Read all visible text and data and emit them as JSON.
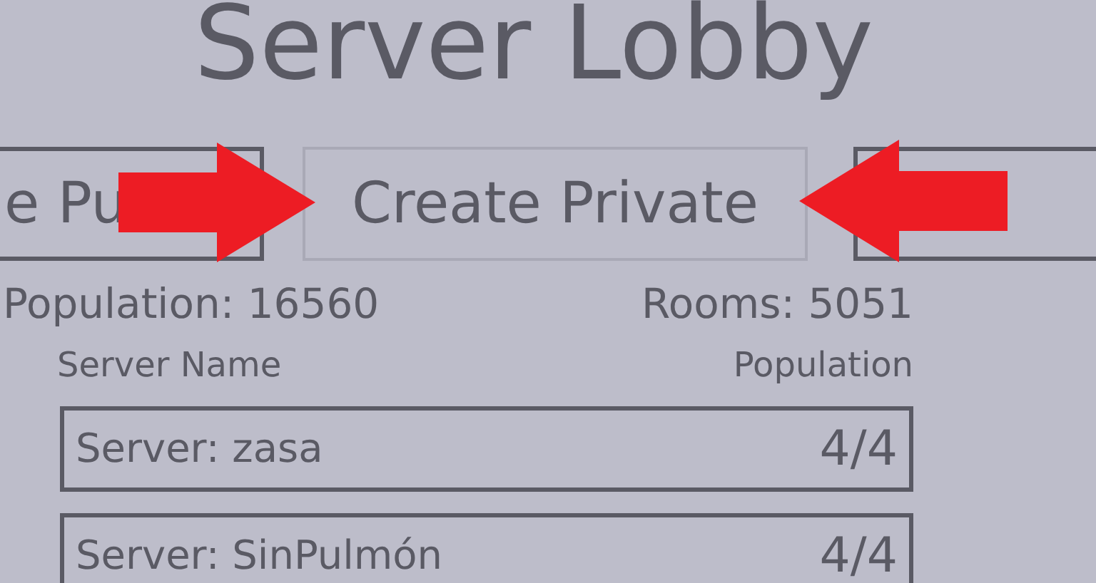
{
  "title": "Server Lobby",
  "buttons": [
    {
      "kind": "text",
      "label": "e Pu",
      "selected": false
    },
    {
      "kind": "text",
      "label": "Create Private",
      "selected": true
    },
    {
      "kind": "covered",
      "selected": false
    }
  ],
  "annotations": [
    {
      "kind": "right"
    },
    {
      "kind": "left"
    }
  ],
  "stats": {
    "population": "Population: 16560",
    "rooms": "Rooms: 5051"
  },
  "table": {
    "columns": [
      "Server Name",
      "Population"
    ],
    "rows": [
      {
        "name": "Server: zasa",
        "population": "4/4"
      },
      {
        "name": "Server: SinPulmón",
        "population": "4/4"
      }
    ]
  }
}
